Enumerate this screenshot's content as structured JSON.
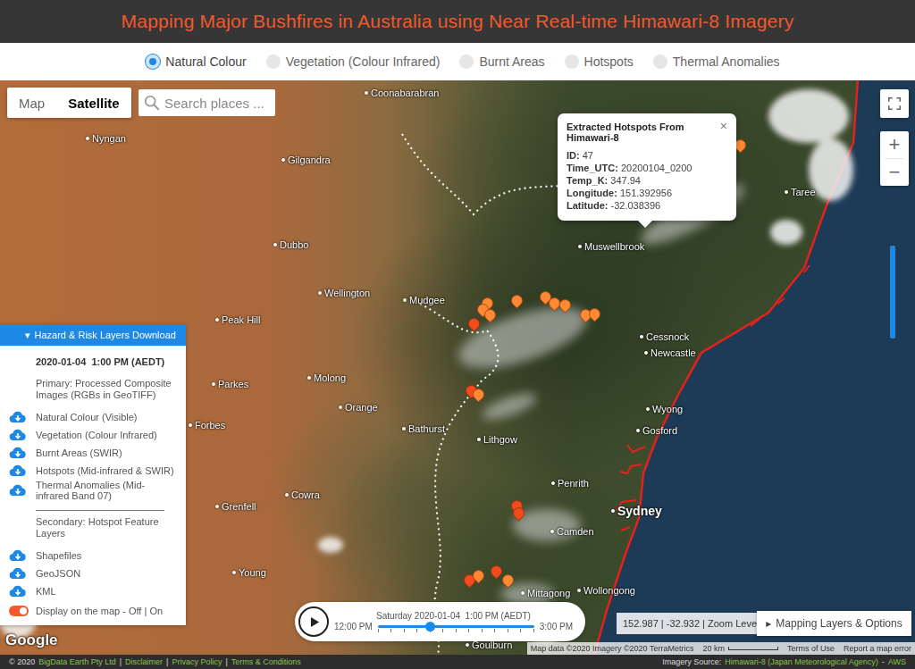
{
  "header": {
    "title": "Mapping Major Bushfires in Australia using Near Real-time Himawari-8 Imagery"
  },
  "layer_tabs": [
    {
      "label": "Natural Colour",
      "selected": true
    },
    {
      "label": "Vegetation (Colour Infrared)",
      "selected": false
    },
    {
      "label": "Burnt Areas",
      "selected": false
    },
    {
      "label": "Hotspots",
      "selected": false
    },
    {
      "label": "Thermal Anomalies",
      "selected": false
    }
  ],
  "map_type": [
    {
      "label": "Map",
      "selected": false
    },
    {
      "label": "Satellite",
      "selected": true
    }
  ],
  "search": {
    "placeholder": "Search places ..."
  },
  "zoom": {
    "in": "+",
    "out": "−"
  },
  "opacity_slider": {
    "level": 1
  },
  "place_labels": [
    {
      "name": "Coonabarabran",
      "major": false
    },
    {
      "name": "Nyngan",
      "major": false
    },
    {
      "name": "Gilgandra",
      "major": false
    },
    {
      "name": "Dubbo",
      "major": false
    },
    {
      "name": "Taree",
      "major": false
    },
    {
      "name": "Muswellbrook",
      "major": false
    },
    {
      "name": "Wellington",
      "major": false
    },
    {
      "name": "Mudgee",
      "major": false
    },
    {
      "name": "Peak Hill",
      "major": false
    },
    {
      "name": "Cessnock",
      "major": false
    },
    {
      "name": "Newcastle",
      "major": false
    },
    {
      "name": "Molong",
      "major": false
    },
    {
      "name": "Parkes",
      "major": false
    },
    {
      "name": "Orange",
      "major": false
    },
    {
      "name": "Forbes",
      "major": false
    },
    {
      "name": "Wyong",
      "major": false
    },
    {
      "name": "Bathurst",
      "major": false
    },
    {
      "name": "Lithgow",
      "major": false
    },
    {
      "name": "Gosford",
      "major": false
    },
    {
      "name": "Penrith",
      "major": false
    },
    {
      "name": "Cowra",
      "major": false
    },
    {
      "name": "Grenfell",
      "major": false
    },
    {
      "name": "Sydney",
      "major": true
    },
    {
      "name": "Camden",
      "major": false
    },
    {
      "name": "Young",
      "major": false
    },
    {
      "name": "Mittagong",
      "major": false
    },
    {
      "name": "Wollongong",
      "major": false
    },
    {
      "name": "Goulburn",
      "major": false
    }
  ],
  "hotspots": [
    {
      "selected": true,
      "color": "#ff8a33"
    },
    {
      "selected": false,
      "color": "#ff8a33"
    },
    {
      "selected": false,
      "color": "#ff8a33"
    },
    {
      "selected": false,
      "color": "#ff8a33"
    },
    {
      "selected": false,
      "color": "#ff8a33"
    },
    {
      "selected": false,
      "color": "#f24b1d"
    },
    {
      "selected": false,
      "color": "#ff8a33"
    },
    {
      "selected": false,
      "color": "#ff8a33"
    },
    {
      "selected": false,
      "color": "#ff8a33"
    },
    {
      "selected": false,
      "color": "#ff8a33"
    },
    {
      "selected": false,
      "color": "#ff8a33"
    },
    {
      "selected": false,
      "color": "#ff8a33"
    },
    {
      "selected": false,
      "color": "#f24b1d"
    },
    {
      "selected": false,
      "color": "#ff8a33"
    },
    {
      "selected": false,
      "color": "#f24b1d"
    },
    {
      "selected": false,
      "color": "#f24b1d"
    },
    {
      "selected": false,
      "color": "#f24b1d"
    },
    {
      "selected": false,
      "color": "#ff8a33"
    },
    {
      "selected": false,
      "color": "#f24b1d"
    },
    {
      "selected": false,
      "color": "#ff8a33"
    }
  ],
  "popup": {
    "title": "Extracted Hotspots From Himawari-8",
    "close": "×",
    "fields": [
      {
        "label": "ID:",
        "value": "47"
      },
      {
        "label": "Time_UTC:",
        "value": "20200104_0200"
      },
      {
        "label": "Temp_K:",
        "value": "347.94"
      },
      {
        "label": "Longitude:",
        "value": "151.392956"
      },
      {
        "label": "Latitude:",
        "value": "-32.038396"
      }
    ]
  },
  "download_panel": {
    "toggle_icon": "▾",
    "title": "Hazard & Risk Layers Download",
    "datetime": "2020-01-04  1:00 PM (AEDT)",
    "primary_heading": "Primary: Processed Composite Images (RGBs in GeoTIFF)",
    "primary_items": [
      "Natural Colour (Visible)",
      "Vegetation (Colour Infrared)",
      "Burnt Areas (SWIR)",
      "Hotspots (Mid-infrared & SWIR)",
      "Thermal Anomalies (Mid-infrared Band 07)"
    ],
    "secondary_heading": "Secondary: Hotspot Feature Layers",
    "secondary_items": [
      "Shapefiles",
      "GeoJSON",
      "KML"
    ],
    "display_toggle": {
      "label": "Display on the map - Off | On",
      "on": true
    }
  },
  "timeline": {
    "current": "Saturday 2020-01-04  1:00 PM (AEDT)",
    "start": "12:00 PM",
    "end": "3:00 PM",
    "level": 0.33
  },
  "coordinates": "152.987 | -32.932 | Zoom Level: 8",
  "layers_button": {
    "icon": "▸",
    "label": "Mapping Layers & Options"
  },
  "google_logo": "Google",
  "attribution": {
    "data": "Map data ©2020 Imagery ©2020 TerraMetrics",
    "scale": "20 km",
    "terms": "Terms of Use",
    "report": "Report a map error"
  },
  "footer": {
    "left": [
      {
        "text": "© 2020",
        "link": false
      },
      {
        "text": "BigData Earth Pty Ltd",
        "link": true
      },
      {
        "text": "|",
        "link": false
      },
      {
        "text": "Disclaimer",
        "link": true
      },
      {
        "text": "|",
        "link": false
      },
      {
        "text": "Privacy Policy",
        "link": true
      },
      {
        "text": "|",
        "link": false
      },
      {
        "text": "Terms & Conditions",
        "link": true
      }
    ],
    "right": [
      {
        "text": "Imagery Source:",
        "link": false
      },
      {
        "text": "Himawari-8 (Japan Meteorological Agency)",
        "link": true
      },
      {
        "text": "-",
        "link": false
      },
      {
        "text": "AWS",
        "link": true
      }
    ]
  }
}
